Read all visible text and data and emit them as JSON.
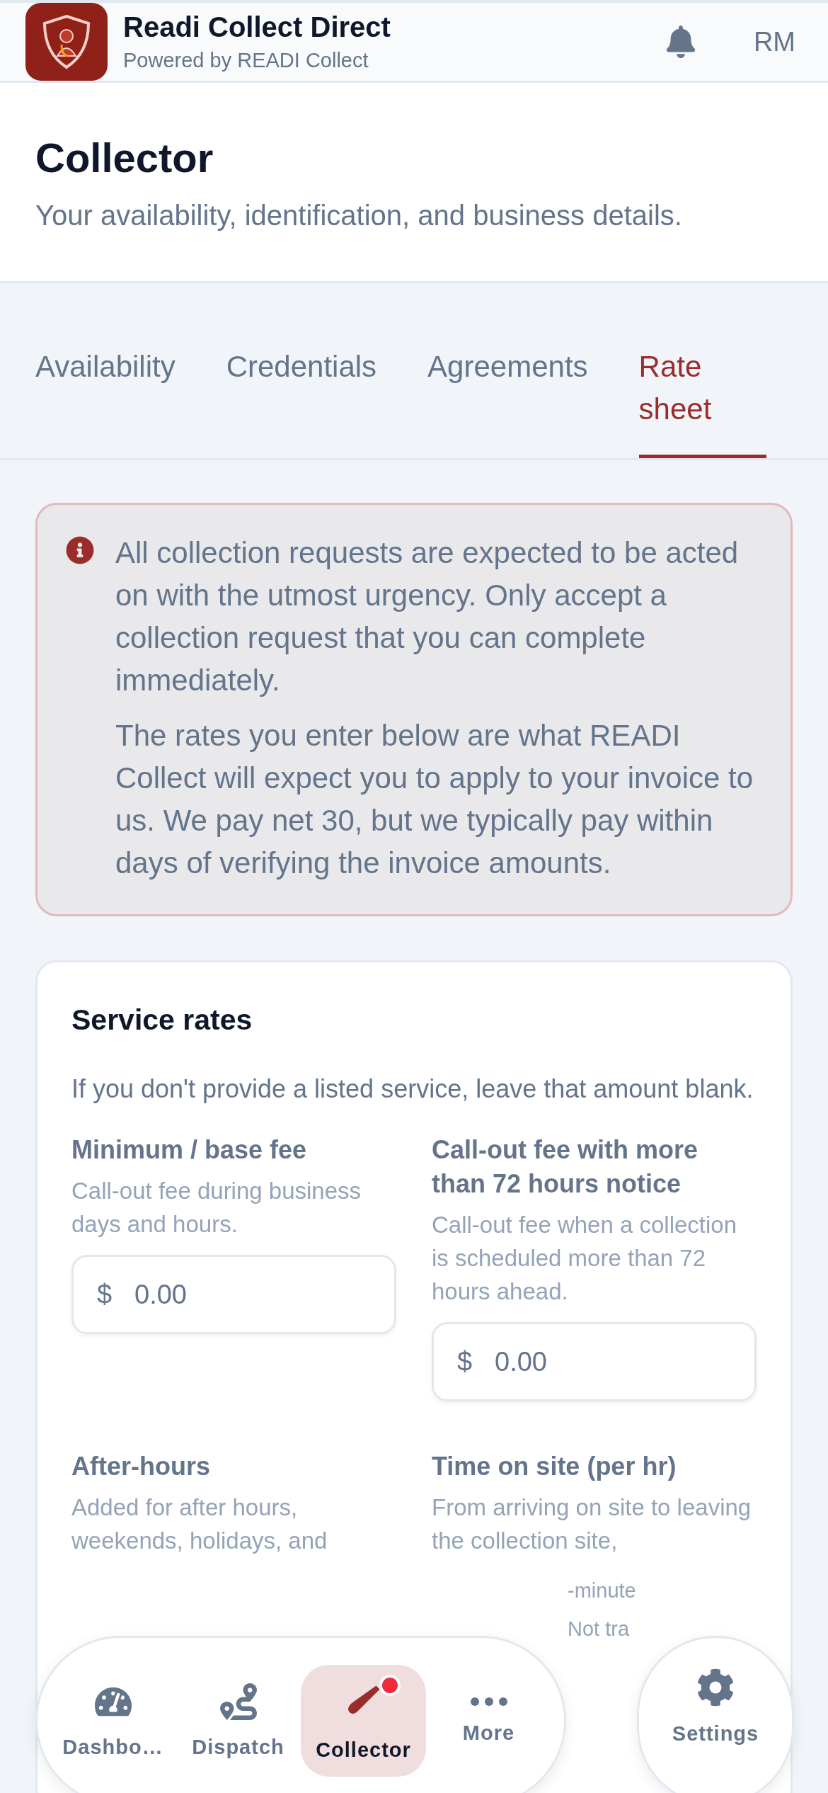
{
  "header": {
    "app_title": "Readi Collect Direct",
    "app_subtitle": "Powered by READI Collect",
    "avatar_initials": "RM"
  },
  "page": {
    "title": "Collector",
    "subtitle": "Your availability, identification, and business details."
  },
  "tabs": [
    {
      "label": "Availability",
      "selected": false
    },
    {
      "label": "Credentials",
      "selected": false
    },
    {
      "label": "Agreements",
      "selected": false
    },
    {
      "label": "Rate sheet",
      "selected": true
    }
  ],
  "notice": {
    "paragraphs": [
      "All collection requests are expected to be acted on with the utmost urgency. Only accept a collection request that you can complete immediately.",
      "The rates you enter below are what READI Collect will expect you to apply to your invoice to us. We pay net 30, but we typically pay within days of verifying the invoice amounts."
    ]
  },
  "service_rates": {
    "title": "Service rates",
    "note": "If you don't provide a listed service, leave that amount blank.",
    "fields": [
      {
        "label": "Minimum / base fee",
        "description": "Call-out fee during business days and hours.",
        "currency": "$",
        "value": "0.00"
      },
      {
        "label": "Call-out fee with more than 72 hours notice",
        "description": "Call-out fee when a collection is scheduled more than 72 hours ahead.",
        "currency": "$",
        "value": "0.00"
      },
      {
        "label": "After-hours",
        "description": "Added for after hours, weekends, holidays, and"
      },
      {
        "label": "Time on site (per hr)",
        "description": "From arriving on site to leaving the collection site,",
        "description_fragments": [
          "-minute",
          "Not tra"
        ]
      }
    ]
  },
  "bottom_nav": {
    "items": [
      {
        "label": "Dashbo…",
        "selected": false,
        "badge": false
      },
      {
        "label": "Dispatch",
        "selected": false,
        "badge": false
      },
      {
        "label": "Collector",
        "selected": true,
        "badge": true
      },
      {
        "label": "More",
        "selected": false,
        "badge": false
      }
    ],
    "settings": {
      "label": "Settings"
    }
  }
}
